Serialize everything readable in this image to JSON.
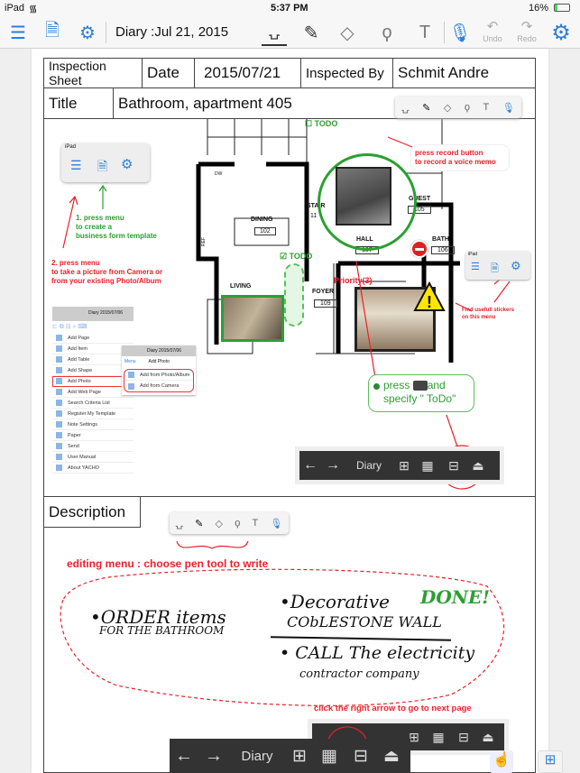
{
  "status": {
    "device": "iPad",
    "time": "5:37 PM",
    "battery": "16%"
  },
  "toolbar": {
    "title": "Diary :Jul 21, 2015",
    "undo": "Undo",
    "redo": "Redo"
  },
  "sheet": {
    "inspection_sheet": "Inspection Sheet",
    "date_label": "Date",
    "date_value": "2015/07/21",
    "inspected_by_label": "Inspected By",
    "inspected_by_value": "Schmit Andre",
    "title_label": "Title",
    "title_value": "Bathroom, apartment 405",
    "description_label": "Description"
  },
  "floorplan": {
    "todo1": "TODO",
    "todo2": "TODO",
    "dining": "DINING",
    "dining_no": "102",
    "stair": "STAIR",
    "stair_no": "11",
    "hall": "HALL",
    "hall_no": "107",
    "guest": "GUEST",
    "guest_no": "105",
    "bath": "BATH",
    "bath_no": "106",
    "living": "LIVING",
    "foyer": "FOYER",
    "foyer_no": "109",
    "dw": "DW",
    "ref": "REF",
    "priority": "Priority(3)"
  },
  "annotations": {
    "step1": "1. press menu\nto create a\nbusiness form template",
    "step2": "2. press menu\nto take a picture from Camera or\nfrom your existing Photo/Album",
    "record": "press record button\nto record a voice memo",
    "stickers": "Find usefull stickers\non this menu",
    "todo_press": "press",
    "todo_and": "and",
    "todo_specify": "specify \" ToDo\"",
    "editing": "editing menu  : choose pen tool to write",
    "next_page": "click the right arrow to go to next page"
  },
  "mini_toolbar": {
    "device": "iPad"
  },
  "menu": {
    "header": "Diary 2015/07/06",
    "items": [
      "Add Page",
      "Add Item",
      "Add Table",
      "Add Shape",
      "Add Photo",
      "Add Web Page",
      "Search Criteria List",
      "Register My Template",
      "Note Settings",
      "Paper",
      "Send",
      "User Manual",
      "About YACHO"
    ],
    "sub_header": "Diary 2015/07/06",
    "sub_back": "Menu",
    "sub_title": "Add Photo",
    "sub_items": [
      "Add from Photo/Album",
      "Add from Camera"
    ]
  },
  "bottombar": {
    "label": "Diary"
  },
  "handwriting": {
    "item1a": "•ORDER items",
    "item1b": "FOR THE BATHROOM",
    "item2a": "•Decorative",
    "item2b": "CObLESTONE WALL",
    "done": "DONE!",
    "item3a": "• CALL The electricity",
    "item3b": "contractor company"
  },
  "colors": {
    "accent": "#2d7fd8",
    "annotation_red": "#e8222a",
    "annotation_green": "#2aa032",
    "bar_dark": "#333333"
  }
}
